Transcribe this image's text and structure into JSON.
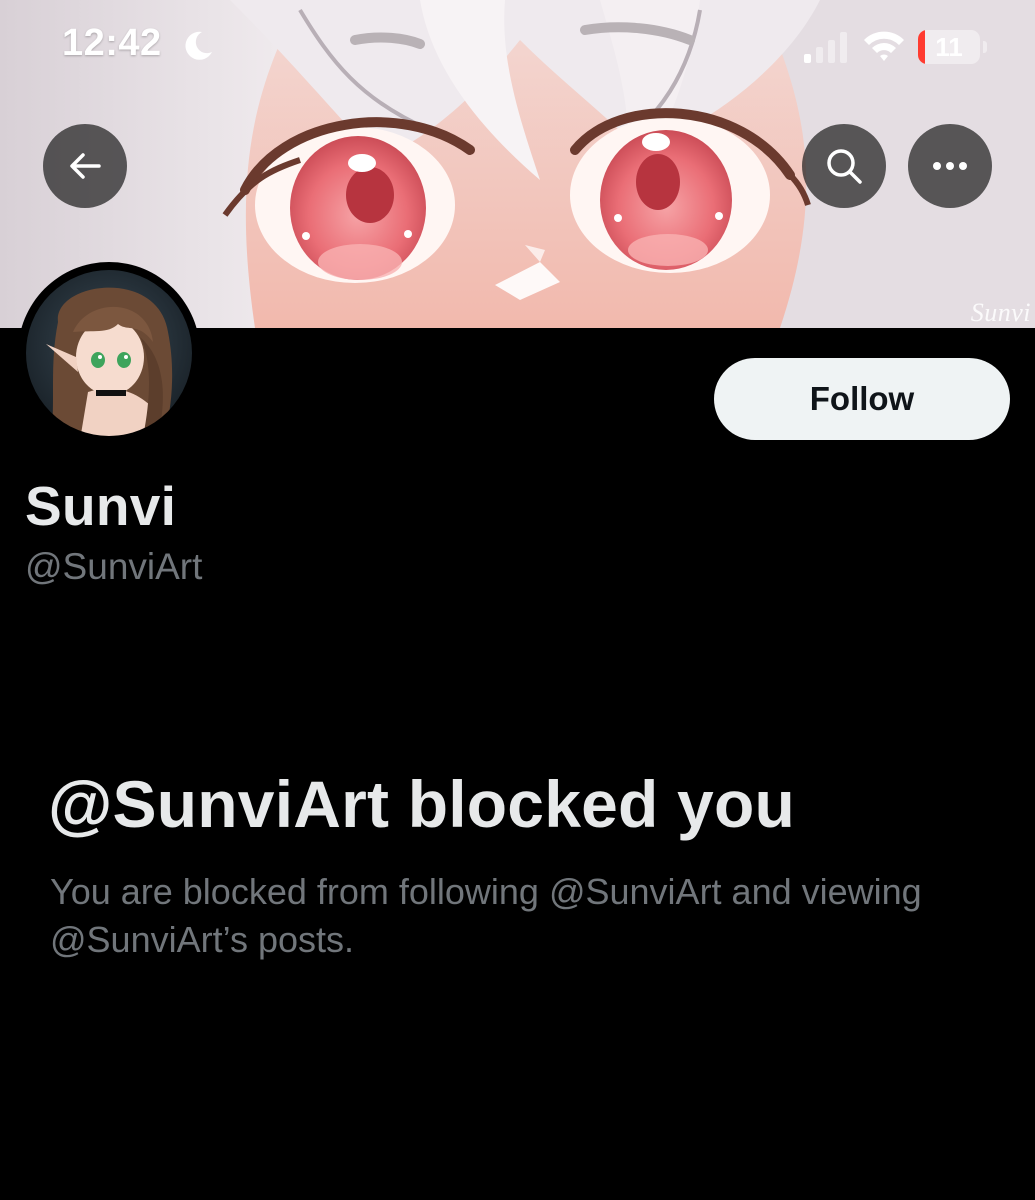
{
  "status_bar": {
    "time": "12:42",
    "battery_level": "11",
    "focus_icon": "moon-icon",
    "signal_icon": "cellular-signal-icon",
    "wifi_icon": "wifi-icon"
  },
  "banner": {
    "watermark": "Sunvi"
  },
  "nav": {
    "back_icon": "arrow-left-icon",
    "search_icon": "search-icon",
    "more_icon": "ellipsis-icon"
  },
  "profile": {
    "display_name": "Sunvi",
    "handle": "@SunviArt",
    "follow_label": "Follow"
  },
  "blocked": {
    "title": "@SunviArt blocked you",
    "message": "You are blocked from following @SunviArt and viewing @SunviArt’s posts."
  },
  "colors": {
    "background": "#000000",
    "primary_text": "#e7e9ea",
    "secondary_text": "#71767b",
    "follow_button_bg": "#eff3f4",
    "follow_button_text": "#0f1419",
    "battery_low": "#ff3b30"
  }
}
